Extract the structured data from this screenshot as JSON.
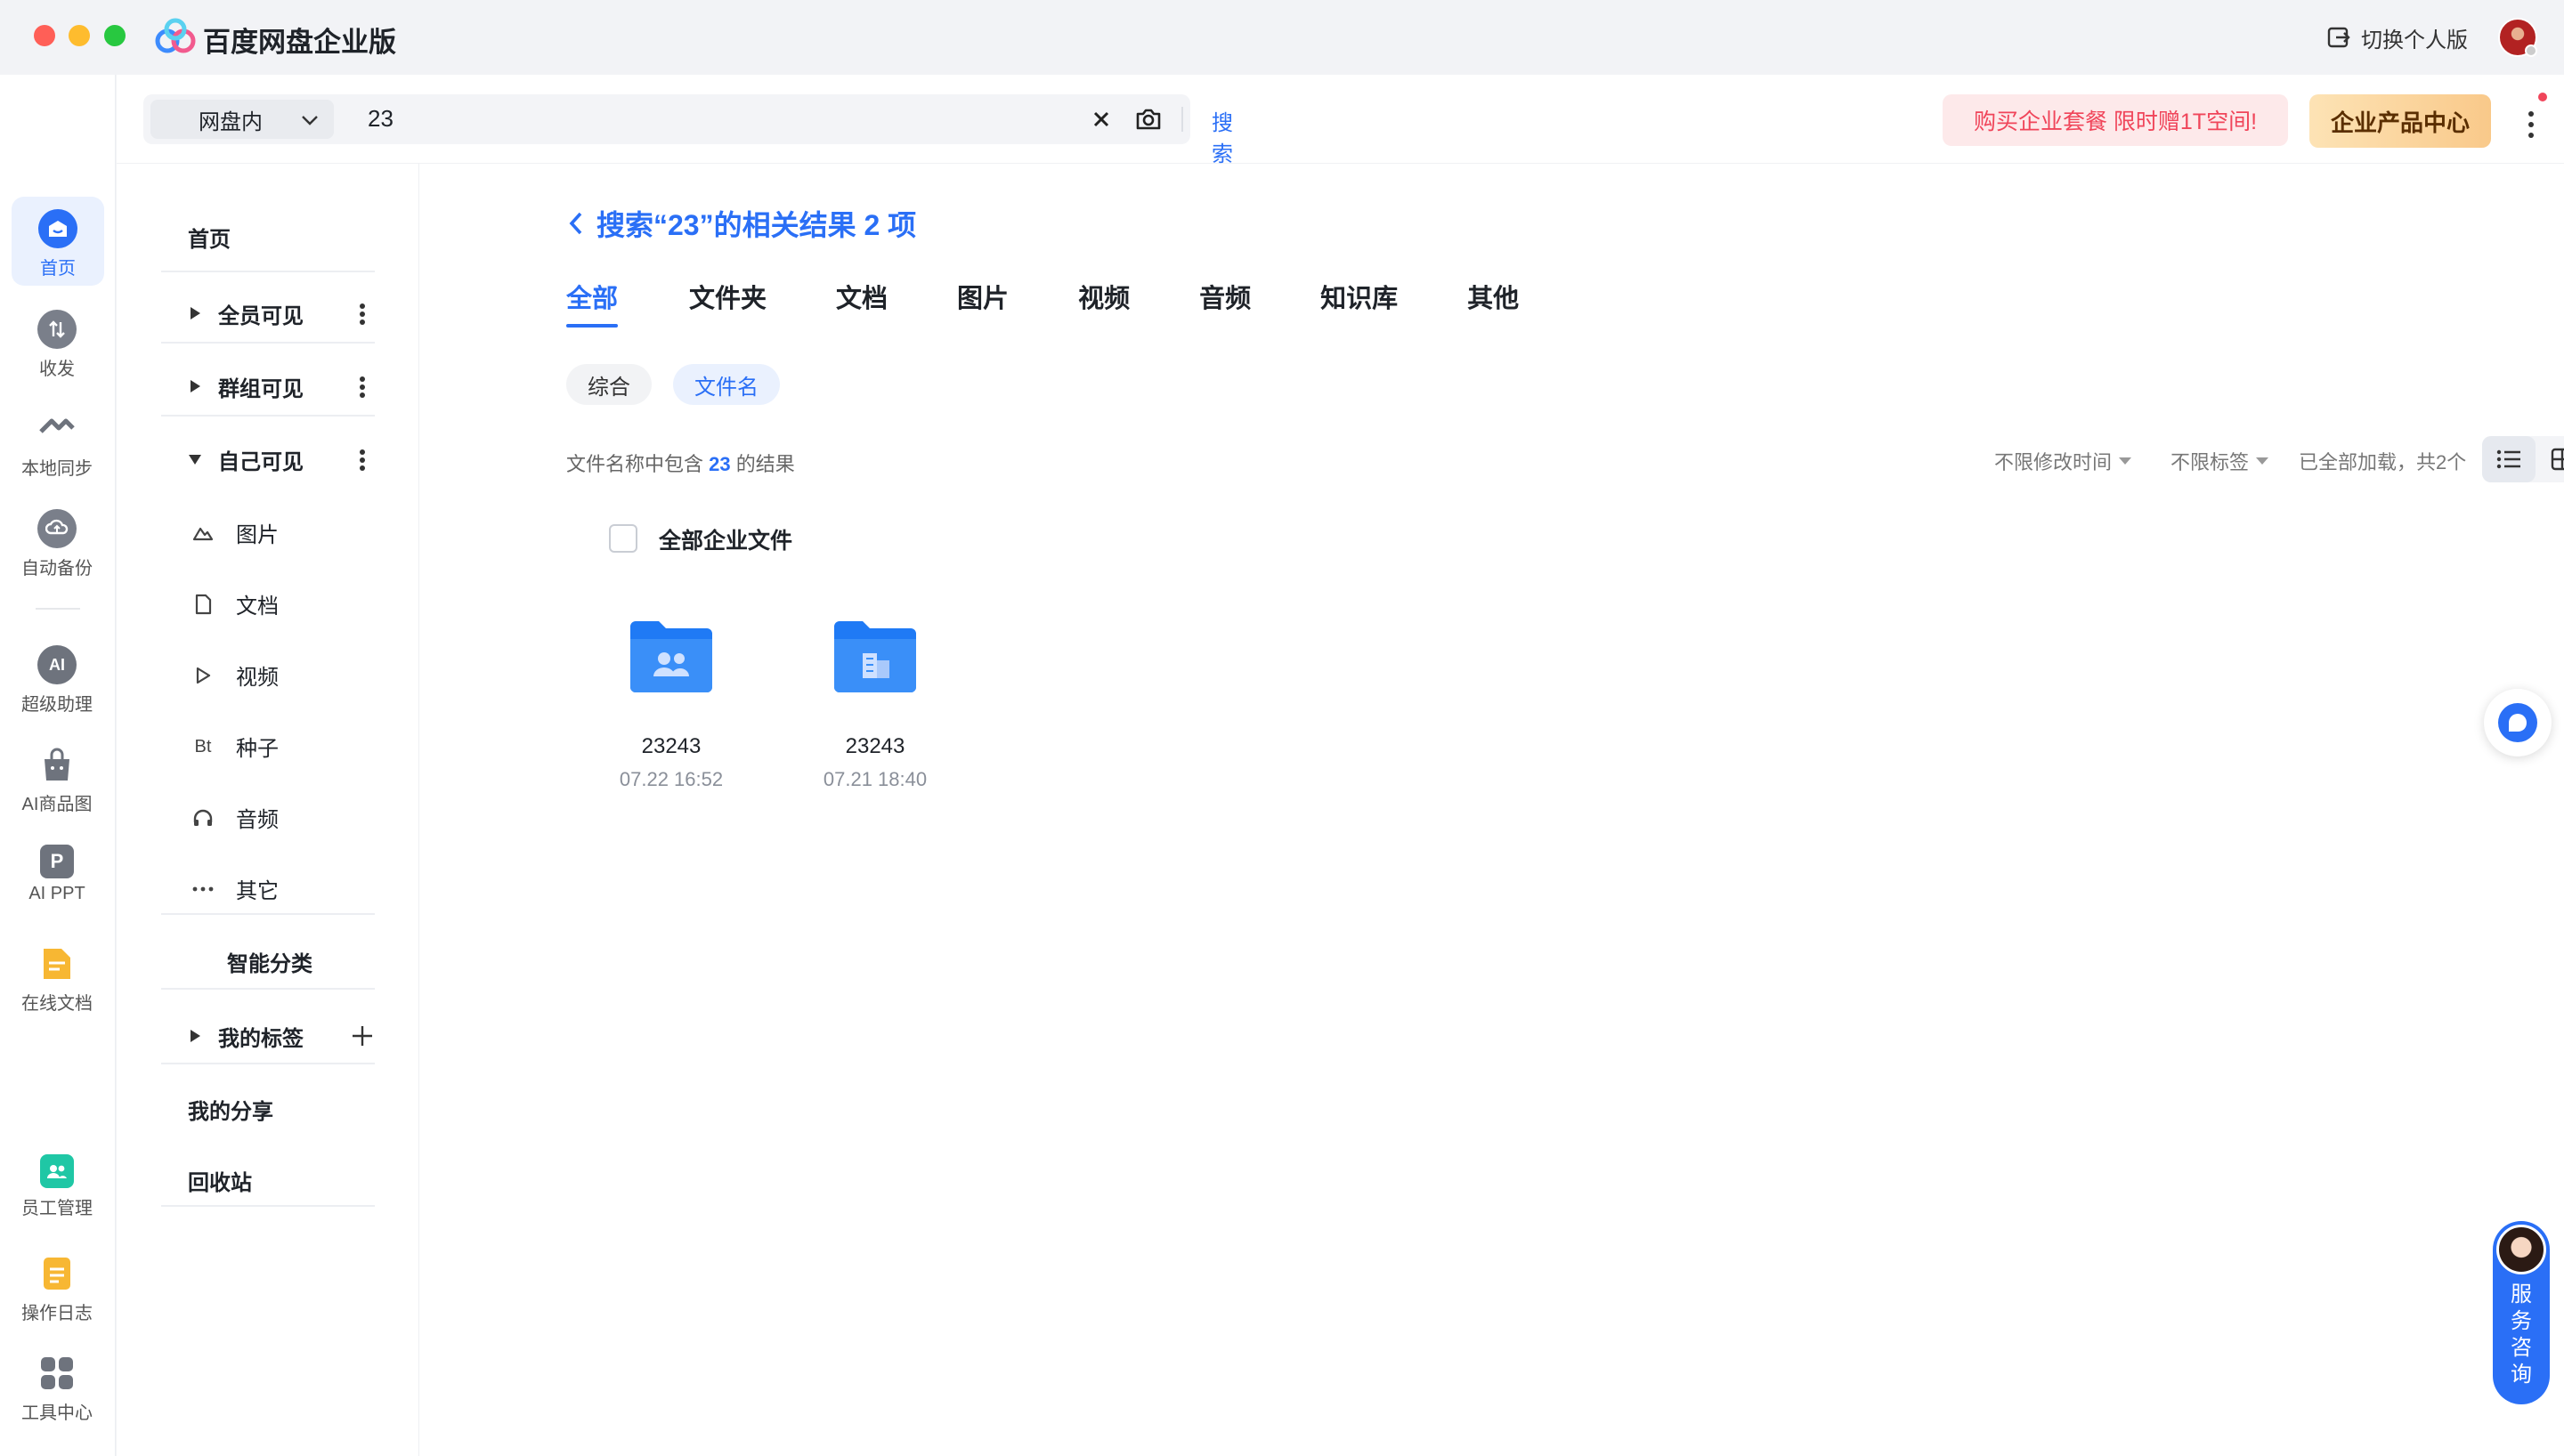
{
  "app": {
    "title": "百度网盘企业版",
    "switch_label": "切换个人版"
  },
  "rail": {
    "items": [
      {
        "label": "首页",
        "icon": "home-icon"
      },
      {
        "label": "收发",
        "icon": "transfer-icon"
      },
      {
        "label": "本地同步",
        "icon": "sync-icon"
      },
      {
        "label": "自动备份",
        "icon": "backup-icon"
      },
      {
        "label": "超级助理",
        "icon": "ai-assistant-icon"
      },
      {
        "label": "AI商品图",
        "icon": "ai-product-image-icon"
      },
      {
        "label": "AI PPT",
        "icon": "ai-ppt-icon"
      },
      {
        "label": "在线文档",
        "icon": "online-doc-icon"
      },
      {
        "label": "员工管理",
        "icon": "staff-icon"
      },
      {
        "label": "操作日志",
        "icon": "log-icon"
      },
      {
        "label": "工具中心",
        "icon": "tools-icon"
      }
    ]
  },
  "search": {
    "scope": "网盘内",
    "query": "23",
    "button": "搜索"
  },
  "promo": {
    "buy_text": "购买企业套餐 限时赠1T空间!",
    "product_center": "企业产品中心"
  },
  "subnav": {
    "home": "首页",
    "all_visible": "全员可见",
    "group_visible": "群组可见",
    "self_visible": "自己可见",
    "types": [
      {
        "label": "图片",
        "icon": "image-icon"
      },
      {
        "label": "文档",
        "icon": "document-icon"
      },
      {
        "label": "视频",
        "icon": "video-icon"
      },
      {
        "label": "种子",
        "icon": "bt-icon",
        "glyph": "Bt"
      },
      {
        "label": "音频",
        "icon": "headphones-icon"
      },
      {
        "label": "其它",
        "icon": "more-dots-icon"
      }
    ],
    "smart_category": "智能分类",
    "my_tags": "我的标签",
    "my_share": "我的分享",
    "recycle": "回收站"
  },
  "results": {
    "title": "搜索“23”的相关结果 2 项",
    "tabs": [
      "全部",
      "文件夹",
      "文档",
      "图片",
      "视频",
      "音频",
      "知识库",
      "其他"
    ],
    "active_tab": "全部",
    "chips": [
      "综合",
      "文件名"
    ],
    "active_chip": "文件名",
    "count_prefix": "文件名称中包含",
    "count_term": "23",
    "count_suffix": "的结果",
    "filter_time": "不限修改时间",
    "filter_tag": "不限标签",
    "loaded": "已全部加载，共2个",
    "all_files_label": "全部企业文件",
    "files": [
      {
        "name": "23243",
        "date": "07.22 16:52",
        "icon": "shared-folder-icon"
      },
      {
        "name": "23243",
        "date": "07.21 18:40",
        "icon": "enterprise-folder-icon"
      }
    ]
  },
  "service": {
    "label": "服务咨询"
  },
  "colors": {
    "accent": "#2a6ff6",
    "promo_text": "#f0455a",
    "folder": "#1f7af5"
  }
}
